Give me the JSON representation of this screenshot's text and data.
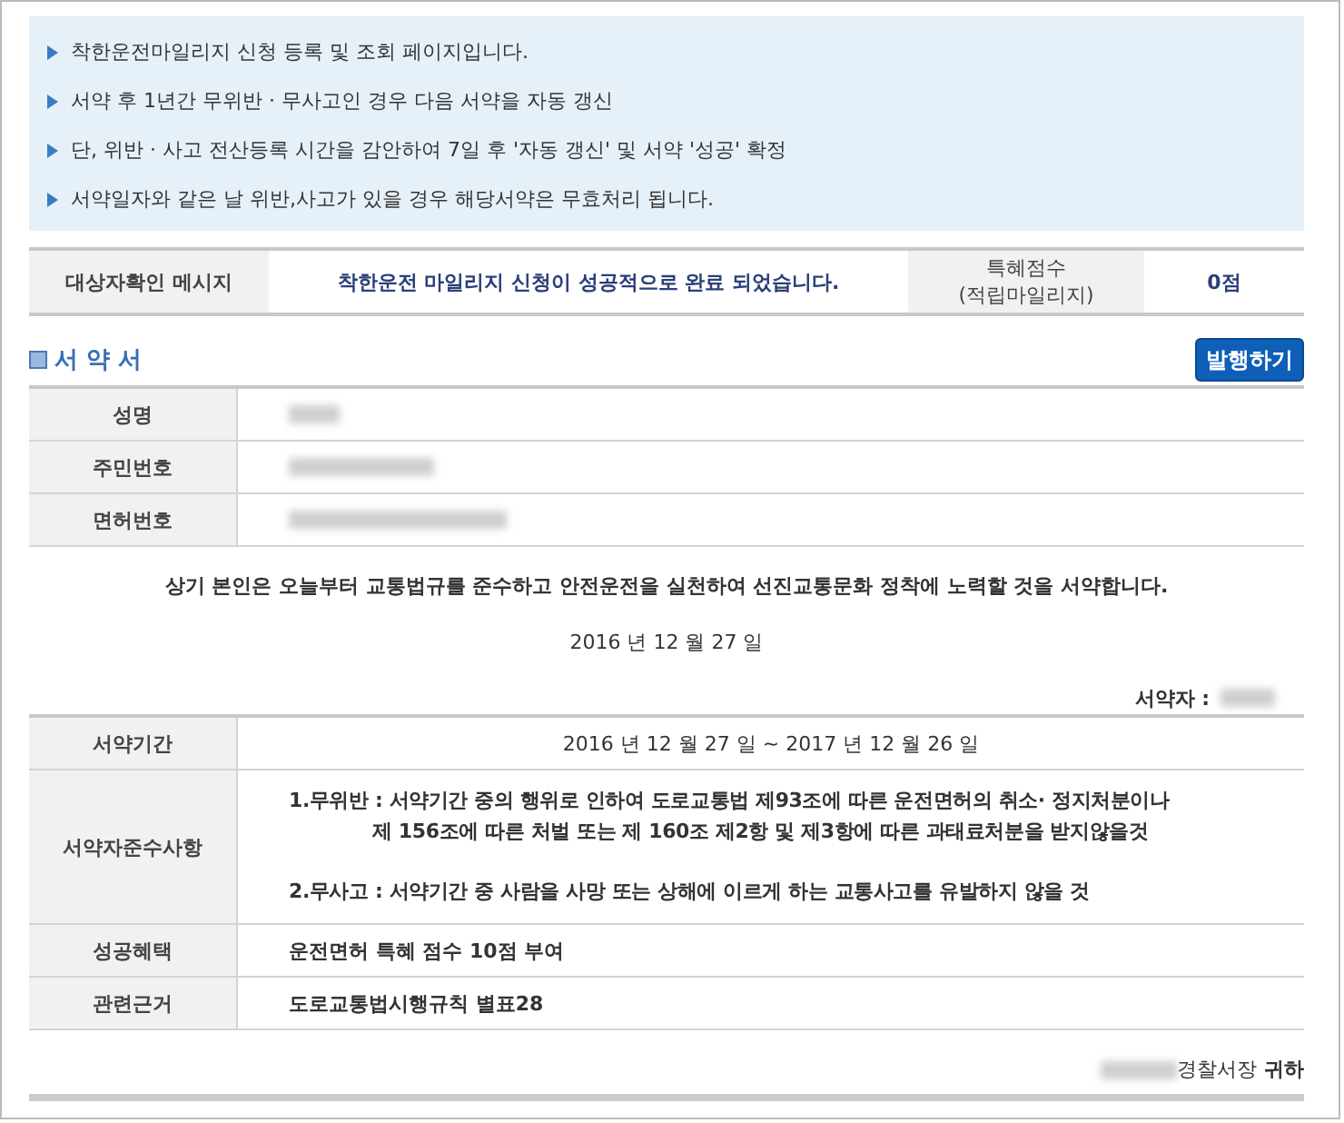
{
  "notices": [
    "착한운전마일리지 신청 등록 및 조회 페이지입니다.",
    "서약 후 1년간 무위반 · 무사고인 경우 다음 서약을 자동 갱신",
    "단, 위반 · 사고 전산등록 시간을 감안하여 7일 후 '자동 갱신' 및 서약 '성공' 확정",
    "서약일자와 같은 날 위반,사고가 있을 경우 해당서약은 무효처리 됩니다."
  ],
  "status": {
    "label": "대상자확인 메시지",
    "message": "착한운전 마일리지 신청이 성공적으로 완료 되었습니다.",
    "points_label": "특혜점수\n(적립마일리지)",
    "points": "0점"
  },
  "pledge": {
    "title": "서 약 서",
    "issue_button": "발행하기",
    "identity_rows": [
      {
        "label": "성명",
        "redacted": true
      },
      {
        "label": "주민번호",
        "redacted": true
      },
      {
        "label": "면허번호",
        "redacted": true
      }
    ],
    "statement": "상기 본인은 오늘부터 교통법규를 준수하고 안전운전을 실천하여 선진교통문화 정착에 노력할 것을 서약합니다.",
    "date": "2016 년 12 월 27 일",
    "signer_label": "서약자 :",
    "signer_redacted": true,
    "terms": [
      {
        "label": "서약기간",
        "kind": "center",
        "lines": [
          "2016 년 12 월 27 일 ~ 2017 년 12 월 26 일"
        ]
      },
      {
        "label": "서약자준수사항",
        "kind": "list",
        "lines": [
          "1.무위반 : 서약기간 중의 행위로 인하여 도로교통법 제93조에 따른 운전면허의 취소· 정지처분이나",
          "제 156조에 따른 처벌 또는 제 160조 제2항 및 제3항에 따른 과태료처분을 받지않을것",
          "2.무사고 : 서약기간 중 사람을 사망 또는 상해에 이르게 하는 교통사고를 유발하지 않을 것"
        ]
      },
      {
        "label": "성공혜택",
        "kind": "text",
        "lines": [
          "운전면허 특혜 점수 10점 부여"
        ]
      },
      {
        "label": "관련근거",
        "kind": "text",
        "lines": [
          "도로교통법시행규칙 별표28"
        ]
      }
    ],
    "addressee": "경찰서장",
    "addressee_redacted": true,
    "honorific": "귀하"
  }
}
